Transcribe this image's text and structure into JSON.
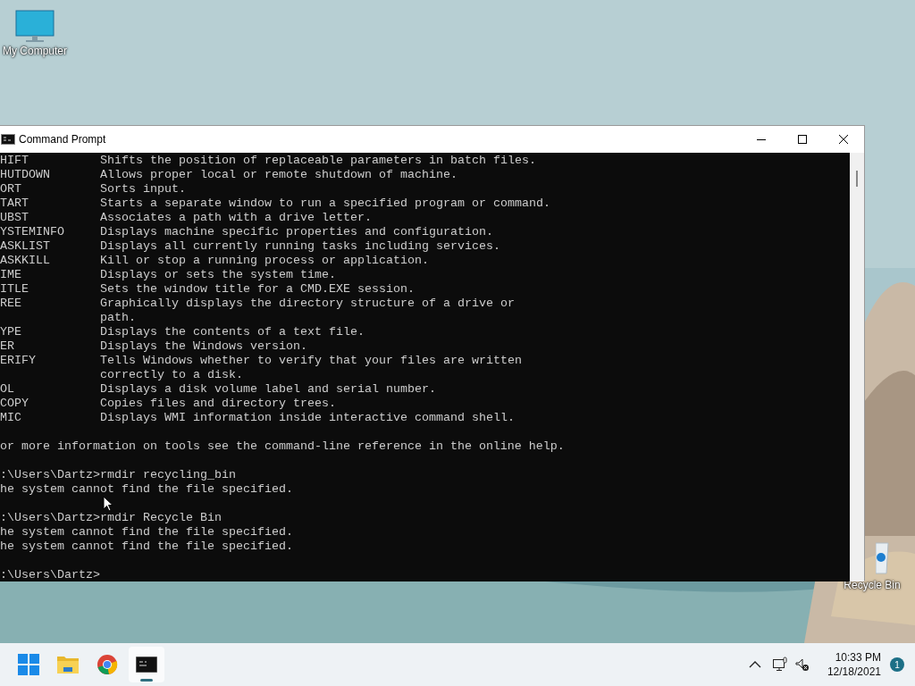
{
  "desktop_icons": [
    {
      "kind": "computer",
      "label": "My Computer"
    },
    {
      "kind": "recycle",
      "label": "Recycle Bin"
    }
  ],
  "window": {
    "title": "Command Prompt"
  },
  "console": {
    "commands": [
      {
        "name": "HIFT",
        "description": [
          "Shifts the position of replaceable parameters in batch files."
        ]
      },
      {
        "name": "HUTDOWN",
        "description": [
          "Allows proper local or remote shutdown of machine."
        ]
      },
      {
        "name": "ORT",
        "description": [
          "Sorts input."
        ]
      },
      {
        "name": "TART",
        "description": [
          "Starts a separate window to run a specified program or command."
        ]
      },
      {
        "name": "UBST",
        "description": [
          "Associates a path with a drive letter."
        ]
      },
      {
        "name": "YSTEMINFO",
        "description": [
          "Displays machine specific properties and configuration."
        ]
      },
      {
        "name": "ASKLIST",
        "description": [
          "Displays all currently running tasks including services."
        ]
      },
      {
        "name": "ASKKILL",
        "description": [
          "Kill or stop a running process or application."
        ]
      },
      {
        "name": "IME",
        "description": [
          "Displays or sets the system time."
        ]
      },
      {
        "name": "ITLE",
        "description": [
          "Sets the window title for a CMD.EXE session."
        ]
      },
      {
        "name": "REE",
        "description": [
          "Graphically displays the directory structure of a drive or",
          "path."
        ]
      },
      {
        "name": "YPE",
        "description": [
          "Displays the contents of a text file."
        ]
      },
      {
        "name": "ER",
        "description": [
          "Displays the Windows version."
        ]
      },
      {
        "name": "ERIFY",
        "description": [
          "Tells Windows whether to verify that your files are written",
          "correctly to a disk."
        ]
      },
      {
        "name": "OL",
        "description": [
          "Displays a disk volume label and serial number."
        ]
      },
      {
        "name": "COPY",
        "description": [
          "Copies files and directory trees."
        ]
      },
      {
        "name": "MIC",
        "description": [
          "Displays WMI information inside interactive command shell."
        ]
      }
    ],
    "paragraphs": [
      [
        "or more information on tools see the command-line reference in the online help."
      ],
      [
        ":\\Users\\Dartz>rmdir recycling_bin",
        "he system cannot find the file specified."
      ],
      [
        ":\\Users\\Dartz>rmdir Recycle Bin",
        "he system cannot find the file specified.",
        "he system cannot find the file specified."
      ],
      [
        ":\\Users\\Dartz>"
      ]
    ]
  },
  "taskbar": {
    "apps": [
      {
        "kind": "start",
        "selected": false
      },
      {
        "kind": "folder",
        "selected": false
      },
      {
        "kind": "chrome",
        "selected": false
      },
      {
        "kind": "terminal",
        "selected": true
      }
    ],
    "time": "10:33 PM",
    "date": "12/18/2021",
    "notifications": "1"
  }
}
